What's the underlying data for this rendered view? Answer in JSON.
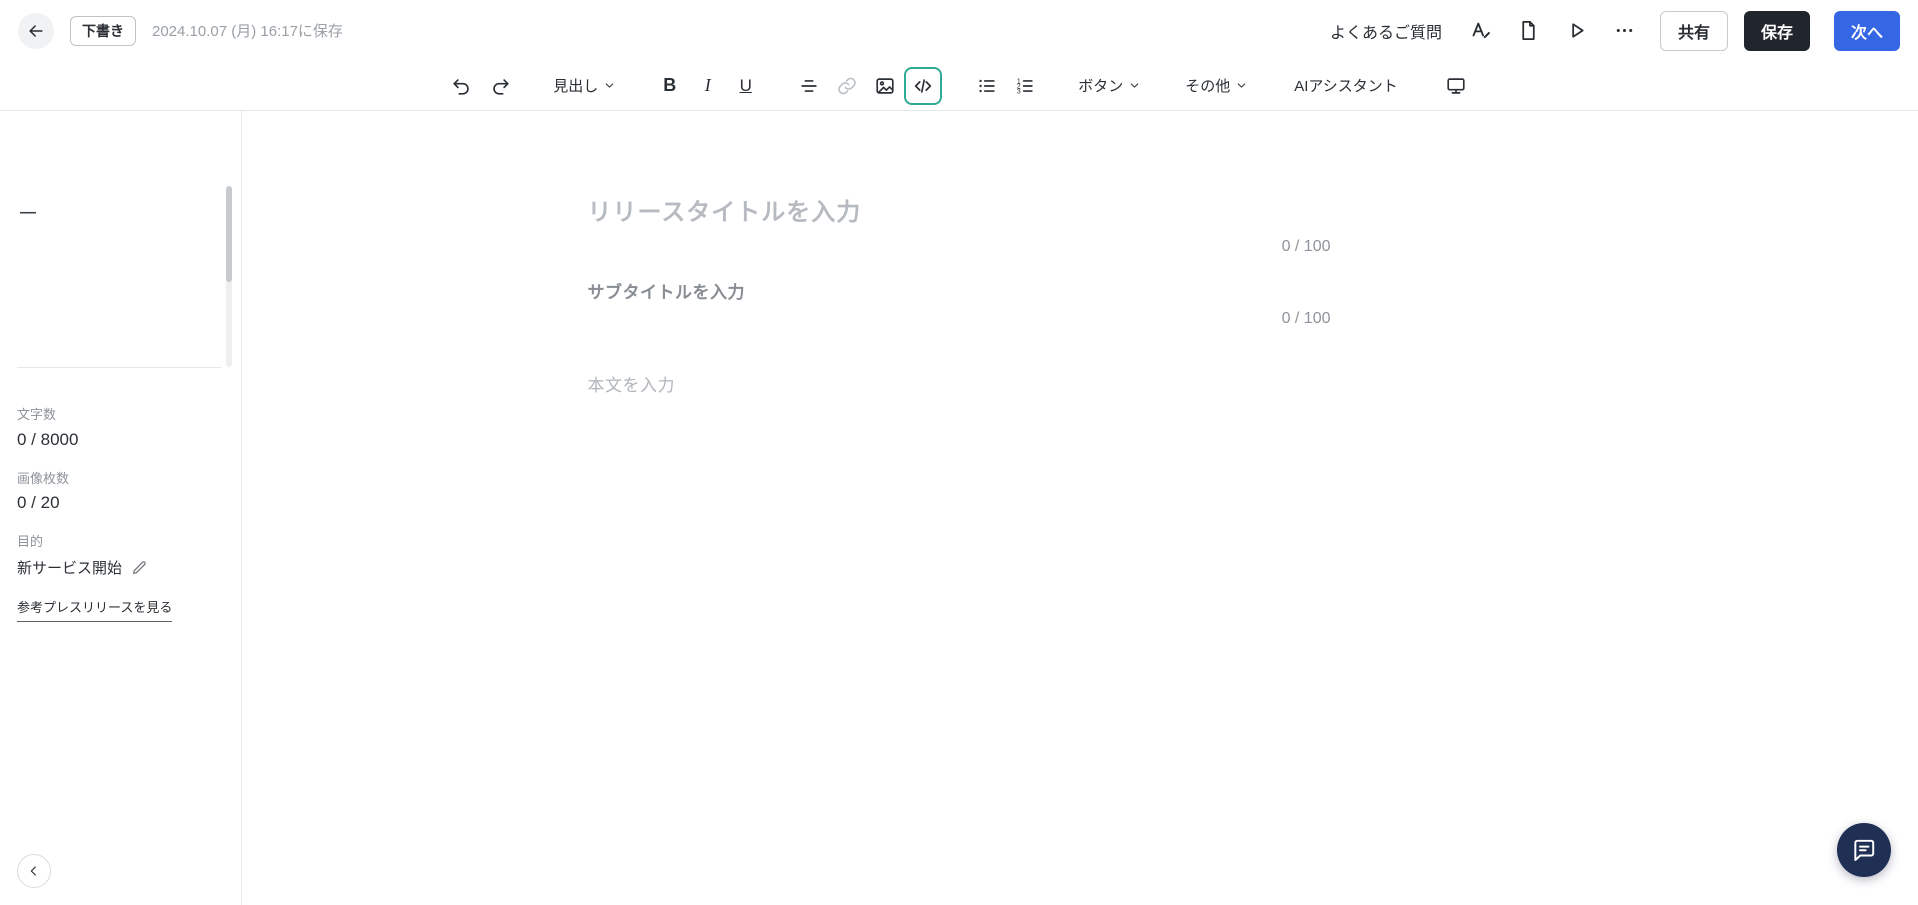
{
  "topbar": {
    "draft_badge": "下書き",
    "saved_at": "2024.10.07 (月) 16:17に保存",
    "faq": "よくあるご質問",
    "share": "共有",
    "save": "保存",
    "next": "次へ"
  },
  "toolbar": {
    "heading": "見出し",
    "bold": "B",
    "italic": "I",
    "underline": "U",
    "button_menu": "ボタン",
    "others": "その他",
    "ai": "AIアシスタント"
  },
  "sidebar": {
    "outline_dash": "—",
    "stats": [
      {
        "label": "文字数",
        "value": "0 / 8000"
      },
      {
        "label": "画像枚数",
        "value": "0 / 20"
      }
    ],
    "purpose_label": "目的",
    "purpose_value": "新サービス開始",
    "reference_link": "参考プレスリリースを見る"
  },
  "editor": {
    "title_placeholder": "リリースタイトルを入力",
    "title_counter": "0 / 100",
    "subtitle_placeholder": "サブタイトルを入力",
    "subtitle_counter": "0 / 100",
    "body_placeholder": "本文を入力"
  },
  "colors": {
    "accent_blue": "#3566e3",
    "save_dark": "#21262c",
    "teal_highlight": "#2fab93",
    "chat_navy": "#203055"
  }
}
